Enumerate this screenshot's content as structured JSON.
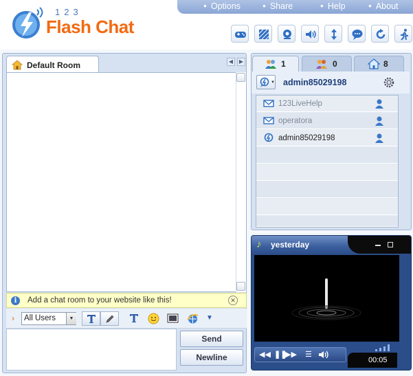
{
  "logo": {
    "number": "123",
    "brand": "Flash Chat"
  },
  "menu": [
    {
      "label": "Options"
    },
    {
      "label": "Share"
    },
    {
      "label": "Help"
    },
    {
      "label": "About"
    }
  ],
  "toolbar_icons": [
    "gamepad-icon",
    "skin-icon",
    "webcam-icon",
    "sound-icon",
    "resize-icon",
    "chat-bubble-icon",
    "refresh-icon",
    "logout-icon"
  ],
  "room": {
    "tab_label": "Default Room"
  },
  "info_bar": {
    "message": "Add a chat room to your website like this!"
  },
  "input_toolbar": {
    "recipient": "All Users"
  },
  "buttons": {
    "send": "Send",
    "newline": "Newline"
  },
  "right_tabs": [
    {
      "label": "1",
      "icon": "users-icon"
    },
    {
      "label": "0",
      "icon": "friends-icon"
    },
    {
      "label": "8",
      "icon": "rooms-icon"
    }
  ],
  "current_user": "admin85029198",
  "users": [
    {
      "name": "123LiveHelp",
      "status_icon": "message-icon",
      "color": "#7f8a99"
    },
    {
      "name": "operatora",
      "status_icon": "message-icon",
      "color": "#7f8a99"
    },
    {
      "name": "admin85029198",
      "status_icon": "chat-status-icon",
      "color": "#222222"
    }
  ],
  "player": {
    "title": "yesterday",
    "time": "00:05"
  },
  "colors": {
    "brand_orange": "#f26a12",
    "accent_blue": "#2b4e8a"
  }
}
